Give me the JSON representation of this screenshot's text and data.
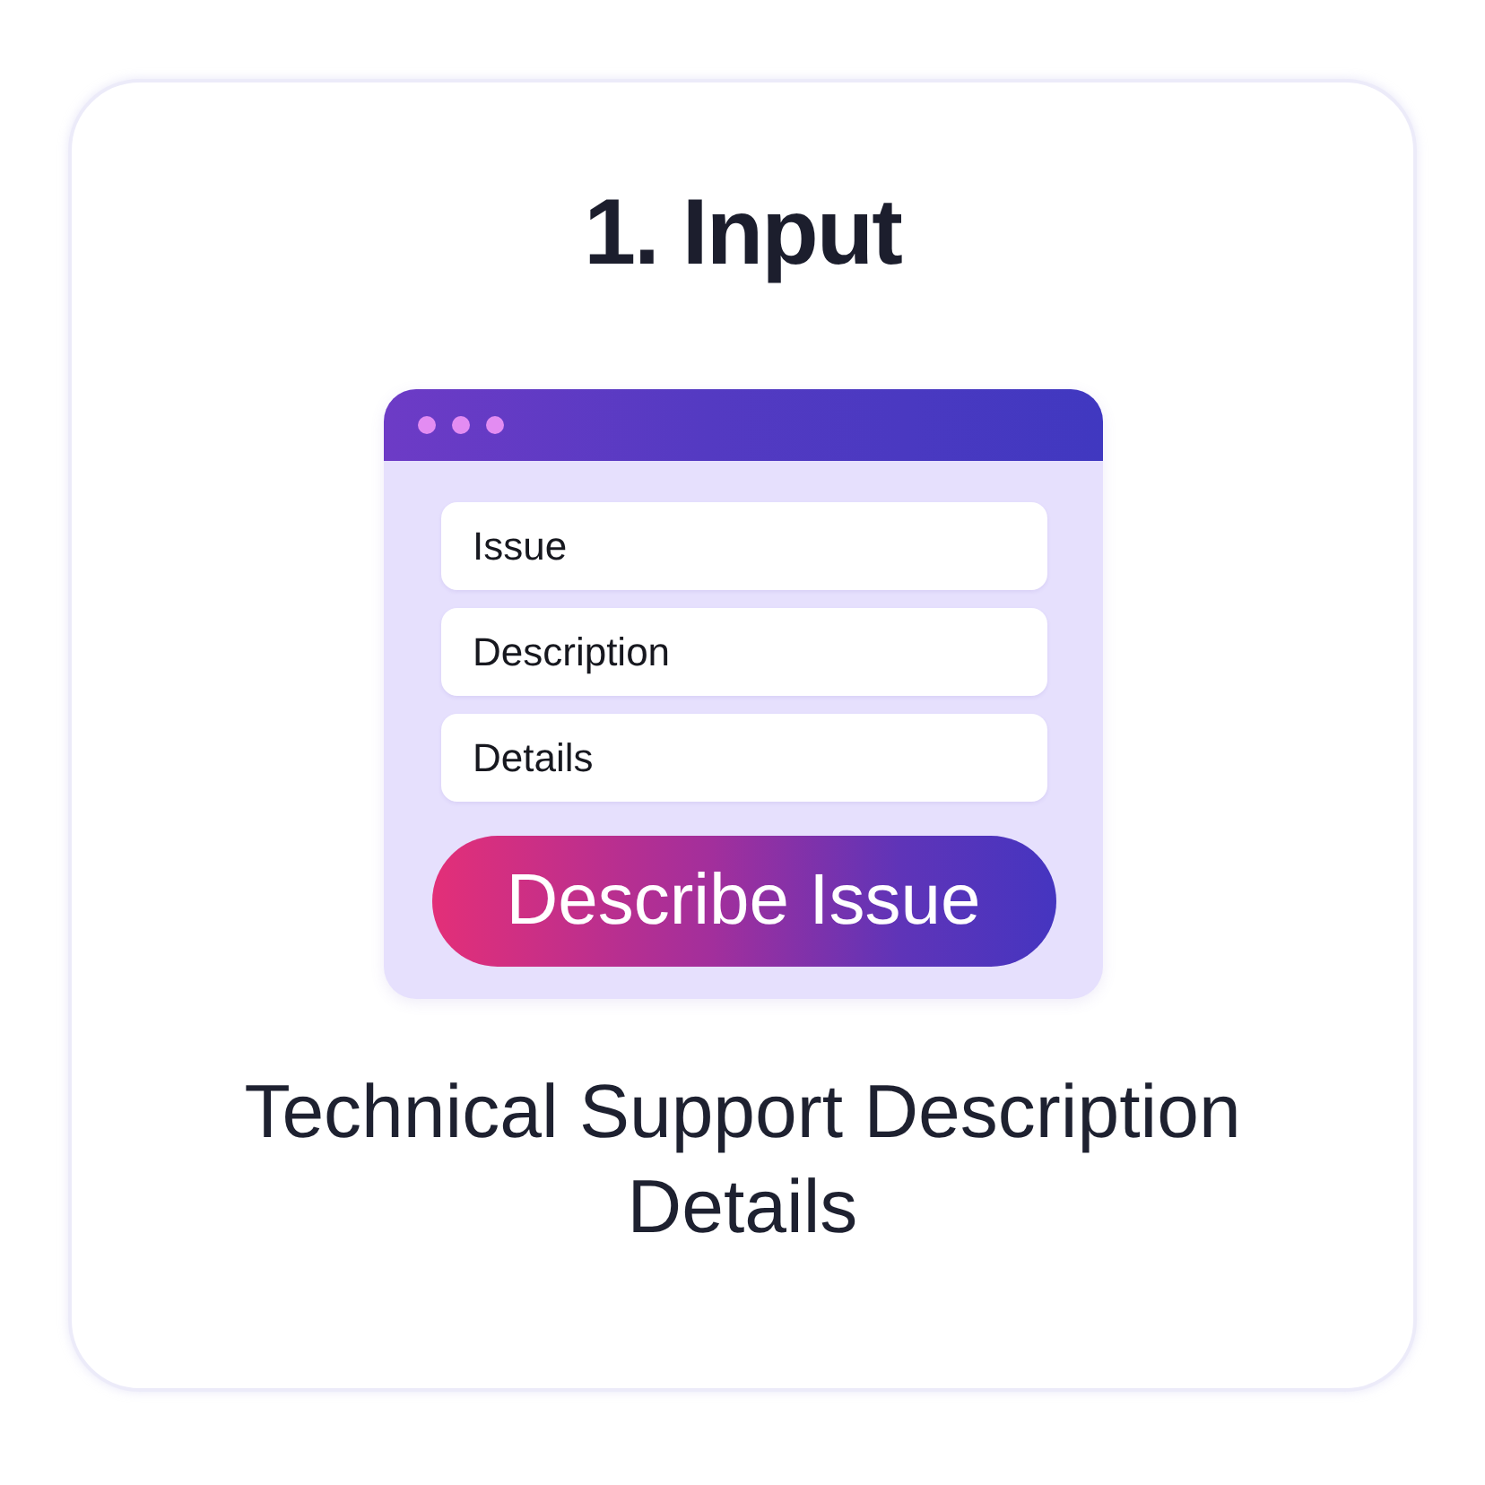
{
  "title": "1. Input",
  "form_window": {
    "fields": [
      {
        "placeholder": "Issue"
      },
      {
        "placeholder": "Description"
      },
      {
        "placeholder": "Details"
      }
    ],
    "button": {
      "label": "Describe Issue"
    }
  },
  "caption": "Technical Support Description Details"
}
